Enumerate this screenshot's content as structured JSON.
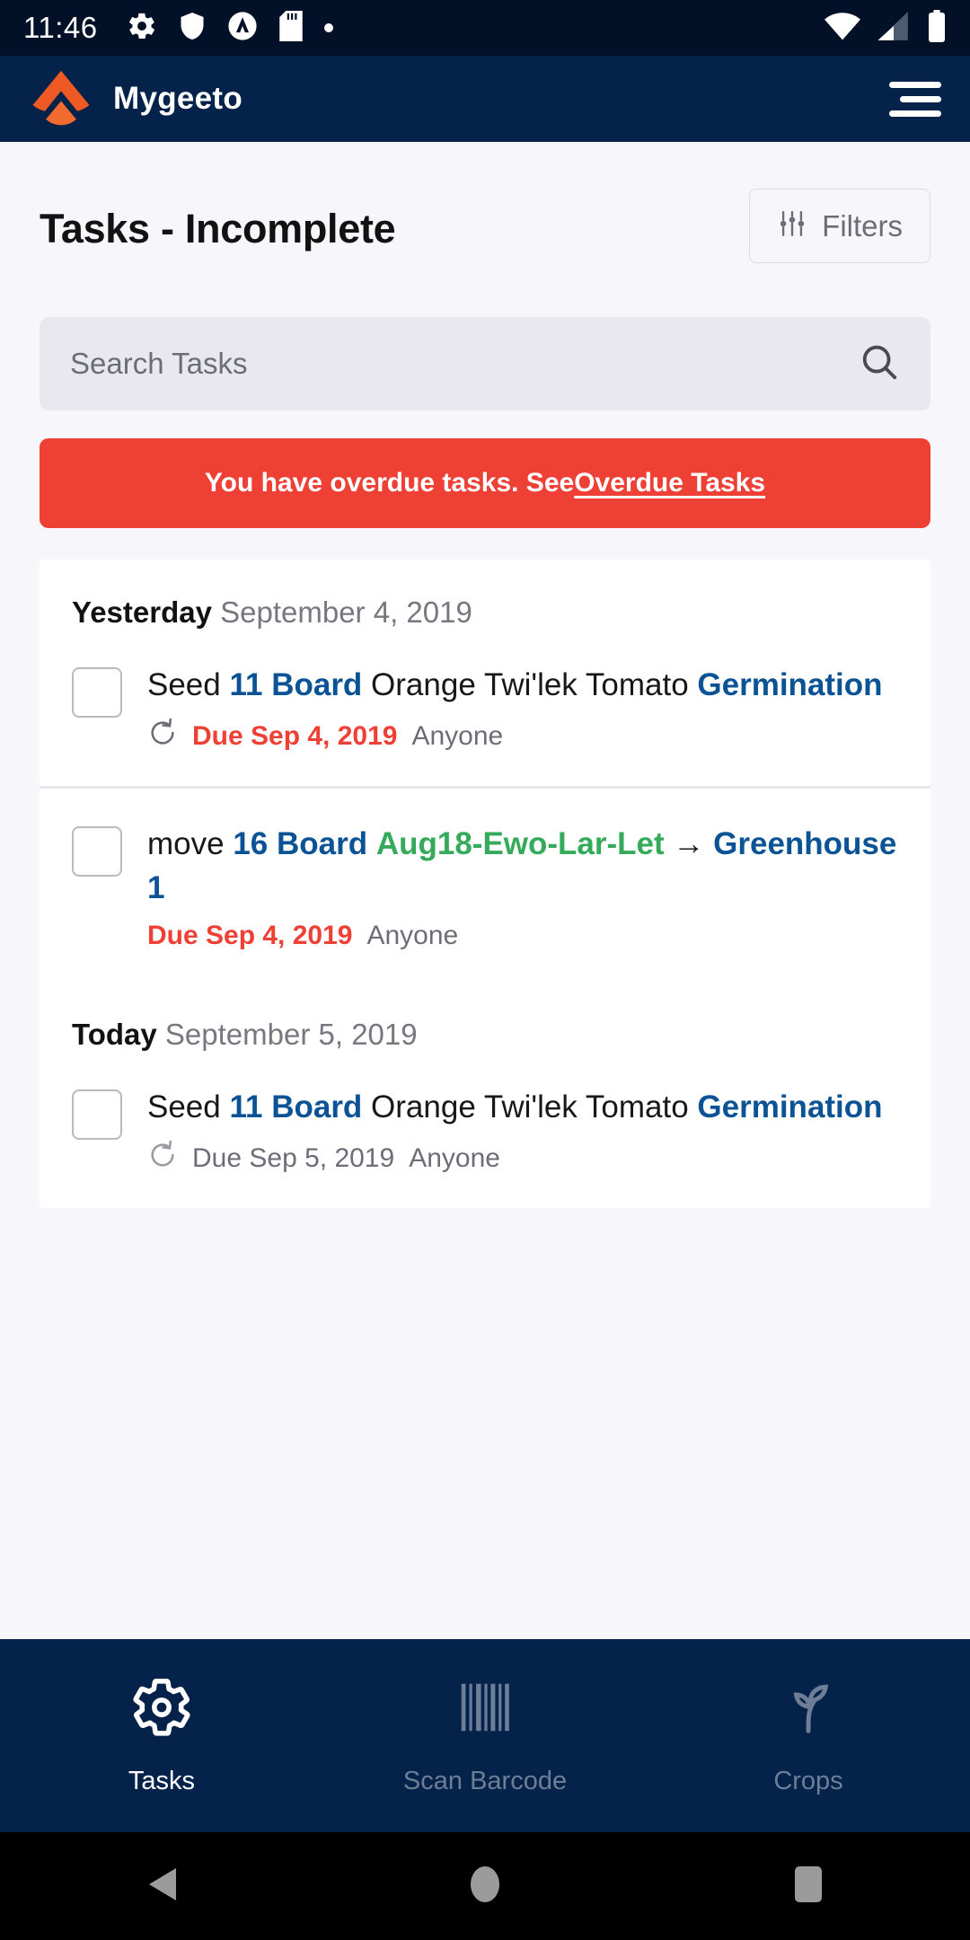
{
  "statusbar": {
    "time": "11:46",
    "left_icons": [
      "gear-icon",
      "shield-icon",
      "circle-a-icon",
      "sd-card-icon",
      "dot-icon"
    ],
    "right_icons": [
      "wifi-icon",
      "cellular-signal-icon",
      "battery-icon"
    ]
  },
  "appbar": {
    "title": "Mygeeto",
    "logo_color": "#f05a28",
    "bg_color": "#04224a",
    "menu_icon": "hamburger-menu-icon"
  },
  "page": {
    "title": "Tasks - Incomplete",
    "filters_label": "Filters",
    "filters_icon": "sliders-icon"
  },
  "search": {
    "placeholder": "Search Tasks",
    "value": "",
    "icon": "search-icon"
  },
  "banner": {
    "prefix": "You have overdue tasks. See ",
    "link_label": "Overdue Tasks",
    "color": "#ef4036"
  },
  "groups": [
    {
      "relative_label": "Yesterday",
      "date_label": "September 4, 2019",
      "tasks": [
        {
          "checked": false,
          "segments": [
            {
              "text": "Seed ",
              "style": "plain"
            },
            {
              "text": "11 Board",
              "style": "blue"
            },
            {
              "text": " Orange Twi'lek Tomato ",
              "style": "plain"
            },
            {
              "text": "Germination",
              "style": "blue"
            }
          ],
          "repeat_icon": true,
          "due_label": "Due Sep 4, 2019",
          "due_overdue": true,
          "assignee": "Anyone"
        },
        {
          "checked": false,
          "segments": [
            {
              "text": "move ",
              "style": "plain"
            },
            {
              "text": "16 Board",
              "style": "blue"
            },
            {
              "text": " ",
              "style": "plain"
            },
            {
              "text": "Aug18-Ewo-Lar-Let",
              "style": "green"
            },
            {
              "text": " → ",
              "style": "arrow"
            },
            {
              "text": "Greenhouse 1",
              "style": "blue"
            }
          ],
          "repeat_icon": false,
          "due_label": "Due Sep 4, 2019",
          "due_overdue": true,
          "assignee": "Anyone"
        }
      ]
    },
    {
      "relative_label": "Today",
      "date_label": "September 5, 2019",
      "tasks": [
        {
          "checked": false,
          "segments": [
            {
              "text": "Seed ",
              "style": "plain"
            },
            {
              "text": "11 Board",
              "style": "blue"
            },
            {
              "text": " Orange Twi'lek Tomato ",
              "style": "plain"
            },
            {
              "text": "Germination",
              "style": "blue"
            }
          ],
          "repeat_icon": true,
          "due_label": "Due Sep 5, 2019",
          "due_overdue": false,
          "assignee": "Anyone"
        }
      ]
    }
  ],
  "bottomnav": {
    "items": [
      {
        "label": "Tasks",
        "icon": "gear-icon",
        "active": true
      },
      {
        "label": "Scan Barcode",
        "icon": "barcode-icon",
        "active": false
      },
      {
        "label": "Crops",
        "icon": "sprout-icon",
        "active": false
      }
    ]
  },
  "androidnav": {
    "items": [
      {
        "name": "back-button",
        "icon": "triangle-left-icon"
      },
      {
        "name": "home-button",
        "icon": "circle-icon"
      },
      {
        "name": "recents-button",
        "icon": "square-icon"
      }
    ]
  },
  "colors": {
    "accent_blue": "#0c5396",
    "accent_green": "#35aa5b",
    "danger_red": "#ef4036",
    "header_navy": "#04224a",
    "statusbar_navy": "#021127"
  }
}
